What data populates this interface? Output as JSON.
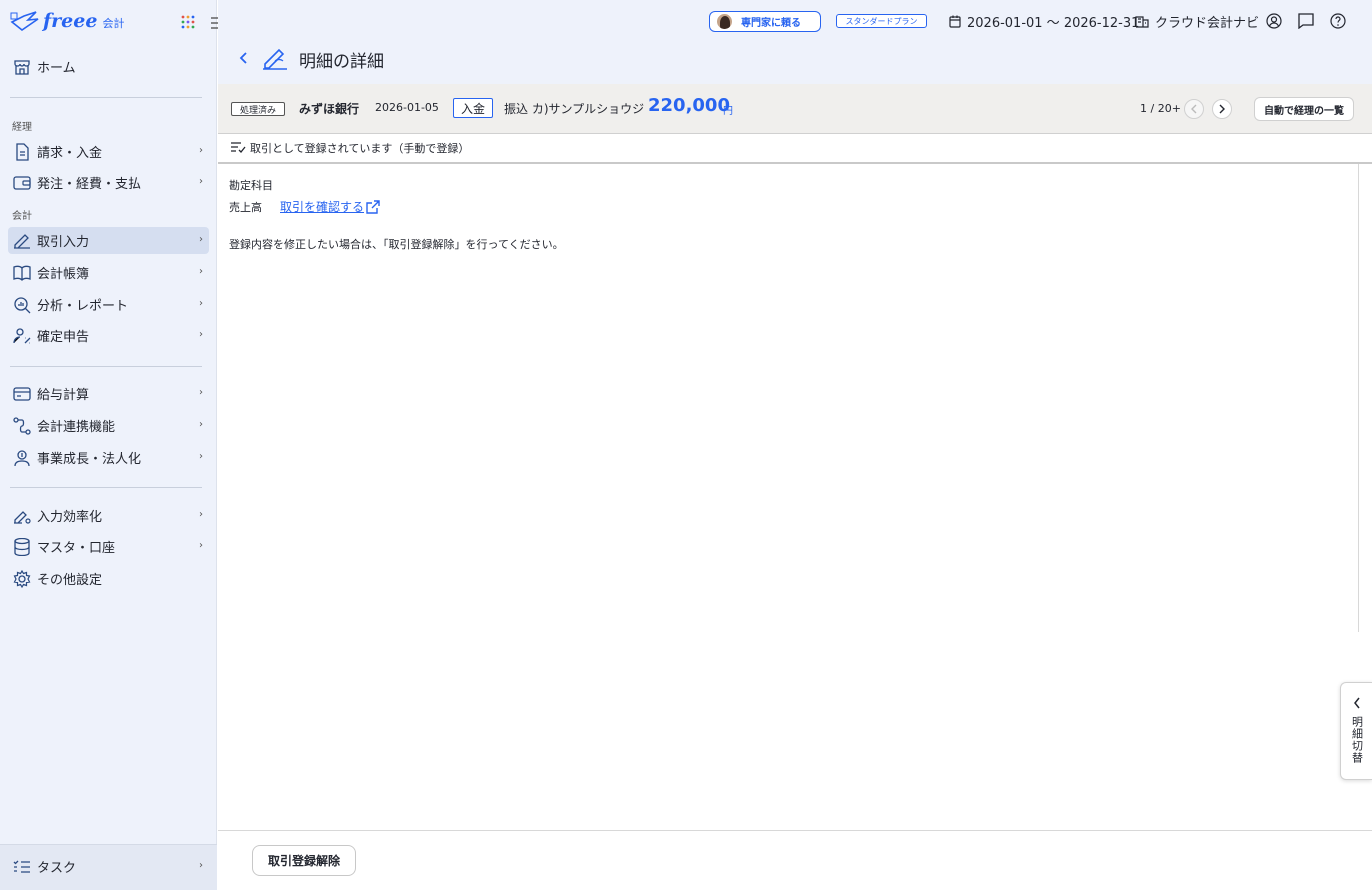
{
  "app": {
    "brand": "freee",
    "product": "会計"
  },
  "sidebar": {
    "home": {
      "label": "ホーム"
    },
    "section_keiri": "経理",
    "section_kaikei": "会計",
    "items": [
      {
        "label": "請求・入金"
      },
      {
        "label": "発注・経費・支払"
      },
      {
        "label": "取引入力"
      },
      {
        "label": "会計帳簿"
      },
      {
        "label": "分析・レポート"
      },
      {
        "label": "確定申告"
      },
      {
        "label": "給与計算"
      },
      {
        "label": "会計連携機能"
      },
      {
        "label": "事業成長・法人化"
      },
      {
        "label": "入力効率化"
      },
      {
        "label": "マスタ・口座"
      },
      {
        "label": "その他設定"
      }
    ],
    "task": {
      "label": "タスク"
    }
  },
  "header": {
    "expert_button": "専門家に頼る",
    "plan": "スタンダードプラン",
    "period": "2026-01-01 〜 2026-12-31",
    "navi": "クラウド会計ナビ"
  },
  "page": {
    "title": "明細の詳細"
  },
  "detail": {
    "status": "処理済み",
    "bank": "みずほ銀行",
    "date": "2026-01-05",
    "type": "入金",
    "description": "振込 カ)サンプルショウジ",
    "amount": "220,000",
    "currency": "円",
    "pager": "1 / 20+",
    "auto_list_button": "自動で経理の一覧"
  },
  "registration": {
    "status_text": "取引として登録されています（手動で登録）"
  },
  "content": {
    "account_label": "勘定科目",
    "account_value": "売上高",
    "confirm_link": "取引を確認する",
    "note": "登録内容を修正したい場合は、「取引登録解除」を行ってください。"
  },
  "side_tab": {
    "label": "明細切替"
  },
  "footer": {
    "unregister_button": "取引登録解除"
  },
  "colors": {
    "accent": "#2864f0",
    "sidebar_bg": "#eef2fb",
    "infobar_bg": "#f0efed"
  }
}
